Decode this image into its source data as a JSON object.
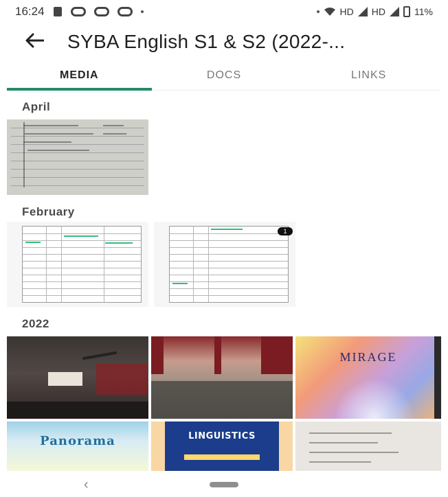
{
  "status_bar": {
    "time": "16:24",
    "network_label": "HD",
    "network_label_2": "HD",
    "battery": "11%",
    "icons": [
      "notification-icon",
      "cloud-icon",
      "cloud-icon",
      "cloud-icon",
      "more-dot-icon",
      "wifi-icon",
      "signal-icon",
      "battery-icon"
    ]
  },
  "app_bar": {
    "back_icon": "arrow-left-icon",
    "title": "SYBA English S1 & S2 (2022-..."
  },
  "tabs": [
    {
      "label": "MEDIA",
      "active": true
    },
    {
      "label": "DOCS",
      "active": false
    },
    {
      "label": "LINKS",
      "active": false
    }
  ],
  "sections": [
    {
      "label": "April",
      "items": [
        "handwritten-sheet"
      ]
    },
    {
      "label": "February",
      "items": [
        "spreadsheet-1",
        "spreadsheet-2"
      ]
    },
    {
      "label": "2022",
      "items": [
        "classroom-photo",
        "group-photo",
        "mirage-cover",
        "panorama-cover",
        "linguistics-cover",
        "document-photo"
      ]
    }
  ],
  "thumb_text": {
    "mirage": "MIRAGE",
    "panorama": "Panorama",
    "linguistics": "LINGUISTICS"
  },
  "badge": "1",
  "colors": {
    "accent": "#25896a"
  },
  "nav_bar": {
    "back_glyph": "‹"
  }
}
